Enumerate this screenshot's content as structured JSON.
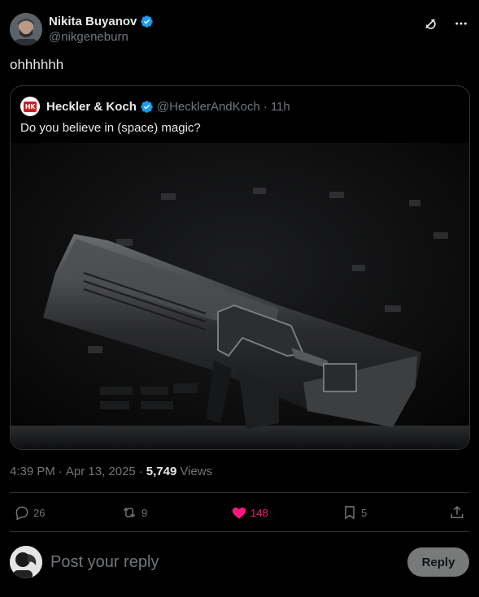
{
  "post": {
    "author_name": "Nikita Buyanov",
    "author_handle": "@nikgeneburn",
    "text": "ohhhhhh"
  },
  "quote": {
    "author_name": "Heckler & Koch",
    "author_handle": "@HecklerAndKoch",
    "separator": "·",
    "age": "11h",
    "text": "Do you believe in (space) magic?",
    "logo_text": "HK"
  },
  "meta": {
    "time": "4:39 PM",
    "dot1": "·",
    "date": "Apr 13, 2025",
    "dot2": "·",
    "views_count": "5,749",
    "views_label": "Views"
  },
  "actions": {
    "replies": "26",
    "reposts": "9",
    "likes": "148",
    "bookmarks": "5"
  },
  "reply_bar": {
    "placeholder": "Post your reply",
    "button_label": "Reply"
  },
  "colors": {
    "background": "#000000",
    "text": "#e7e9ea",
    "secondary": "#71767b",
    "verified": "#1d9bf0",
    "like": "#f91880",
    "border": "#2f3336",
    "hk_red": "#d71920"
  }
}
